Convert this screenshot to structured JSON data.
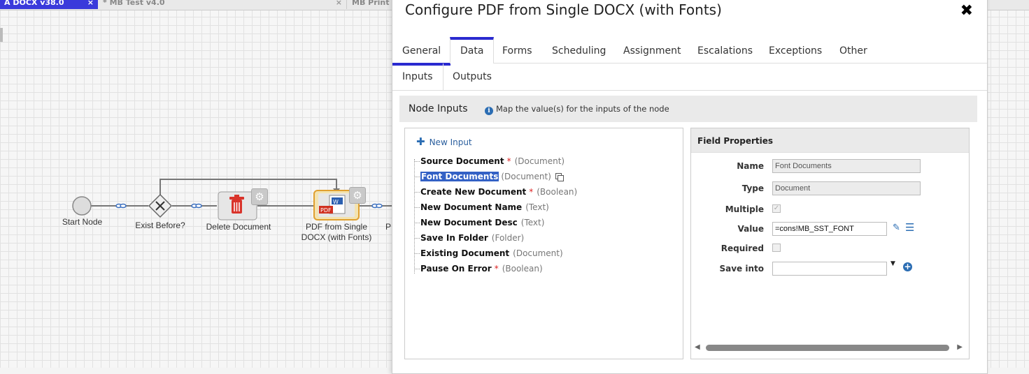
{
  "tabs": [
    {
      "label": "A DOCX v38.0",
      "close": "×"
    },
    {
      "label": "* MB Test v4.0",
      "close": "×"
    },
    {
      "label": "MB Print"
    }
  ],
  "process_nodes": {
    "start": "Start Node",
    "gateway": "Exist Before?",
    "delete": "Delete Document",
    "pdf_line1": "PDF from Single",
    "pdf_line2": "DOCX (with Fonts)",
    "next": "P"
  },
  "modal": {
    "title": "Configure PDF from Single DOCX (with Fonts)",
    "close": "✖",
    "tabs": [
      "General",
      "Data",
      "Forms",
      "Scheduling",
      "Assignment",
      "Escalations",
      "Exceptions",
      "Other"
    ],
    "active_tab": "Data",
    "subtabs": [
      "Inputs",
      "Outputs"
    ],
    "active_subtab": "Inputs",
    "node_inputs": {
      "heading": "Node Inputs",
      "info": "Map the value(s) for the inputs of the node"
    },
    "new_input": "New Input",
    "inputs": [
      {
        "name": "Source Document",
        "required": "*",
        "type": "(Document)"
      },
      {
        "name": "Font Documents",
        "required": "",
        "type": "(Document)",
        "selected": true
      },
      {
        "name": "Create New Document",
        "required": "*",
        "type": "(Boolean)"
      },
      {
        "name": "New Document Name",
        "required": "",
        "type": "(Text)"
      },
      {
        "name": "New Document Desc",
        "required": "",
        "type": "(Text)"
      },
      {
        "name": "Save In Folder",
        "required": "",
        "type": "(Folder)"
      },
      {
        "name": "Existing Document",
        "required": "",
        "type": "(Document)"
      },
      {
        "name": "Pause On Error",
        "required": "*",
        "type": "(Boolean)"
      }
    ],
    "field_properties": {
      "heading": "Field Properties",
      "name_label": "Name",
      "name_value": "Font Documents",
      "type_label": "Type",
      "type_value": "Document",
      "multiple_label": "Multiple",
      "multiple_checked": true,
      "value_label": "Value",
      "value_value": "=cons!MB_SST_FONT",
      "required_label": "Required",
      "required_checked": false,
      "save_into_label": "Save into",
      "save_into_value": ""
    }
  }
}
